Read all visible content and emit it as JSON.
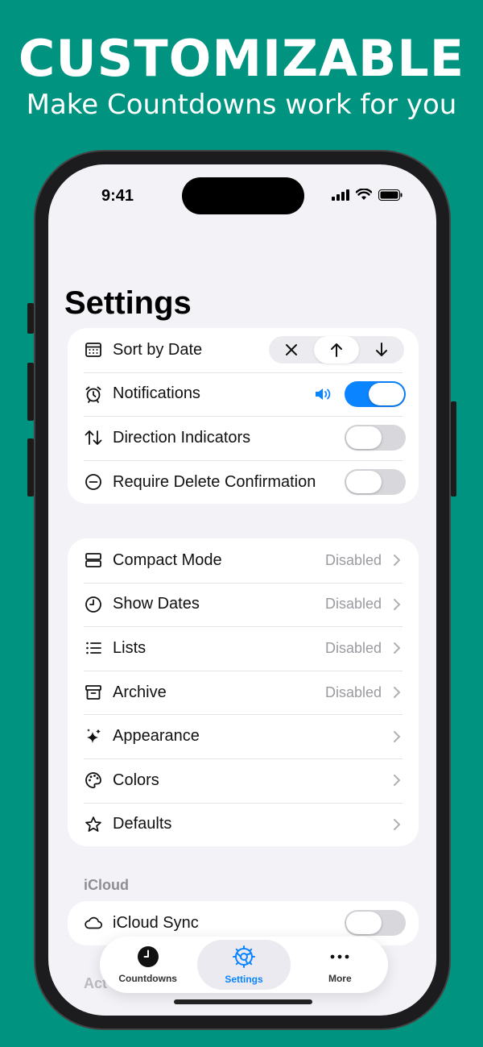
{
  "promo": {
    "headline": "CUSTOMIZABLE",
    "subhead": "Make Countdowns work for you"
  },
  "status_bar": {
    "time": "9:41"
  },
  "page": {
    "title": "Settings"
  },
  "group1": {
    "sort": {
      "label": "Sort by Date",
      "selected": "ascending"
    },
    "notifications": {
      "label": "Notifications",
      "enabled": true
    },
    "direction": {
      "label": "Direction Indicators",
      "enabled": false
    },
    "delete_confirm": {
      "label": "Require Delete Confirmation",
      "enabled": false
    }
  },
  "group2": {
    "compact": {
      "label": "Compact Mode",
      "value": "Disabled"
    },
    "show_dates": {
      "label": "Show Dates",
      "value": "Disabled"
    },
    "lists": {
      "label": "Lists",
      "value": "Disabled"
    },
    "archive": {
      "label": "Archive",
      "value": "Disabled"
    },
    "appearance": {
      "label": "Appearance"
    },
    "colors": {
      "label": "Colors"
    },
    "defaults": {
      "label": "Defaults"
    }
  },
  "icloud": {
    "header": "iCloud",
    "sync": {
      "label": "iCloud Sync",
      "enabled": false
    },
    "peek_header": "Act"
  },
  "tabbar": {
    "countdowns": "Countdowns",
    "settings": "Settings",
    "more": "More",
    "active": "settings"
  },
  "colors": {
    "background": "#009480",
    "accent": "#0a84ff"
  }
}
